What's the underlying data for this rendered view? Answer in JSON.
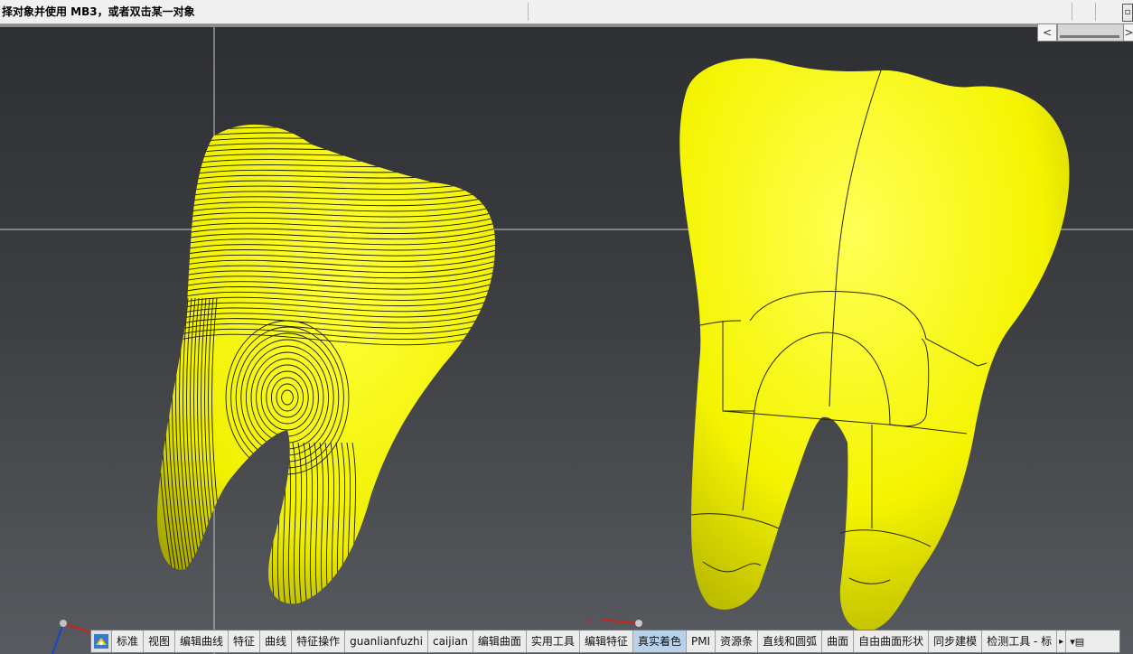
{
  "status": {
    "prompt": "择对象并使用 MB3，或者双击某一对象"
  },
  "scroll": {
    "left_arrow": "<",
    "right_arrow": ">"
  },
  "colors": {
    "tooth_fill": "#f2f200",
    "viewport_top": "#2d2f32",
    "viewport_bottom": "#575a5e",
    "toolbar_active": "#b8d2ec"
  },
  "toolbar": {
    "tabs": [
      {
        "label": "标准"
      },
      {
        "label": "视图"
      },
      {
        "label": "编辑曲线"
      },
      {
        "label": "特征"
      },
      {
        "label": "曲线"
      },
      {
        "label": "特征操作"
      },
      {
        "label": "guanlianfuzhi"
      },
      {
        "label": "caijian"
      },
      {
        "label": "编辑曲面"
      },
      {
        "label": "实用工具"
      },
      {
        "label": "编辑特征"
      },
      {
        "label": "真实着色",
        "active": true
      },
      {
        "label": "PMI"
      },
      {
        "label": "资源条"
      },
      {
        "label": "直线和圆弧"
      },
      {
        "label": "曲面"
      },
      {
        "label": "自由曲面形状"
      },
      {
        "label": "同步建模"
      },
      {
        "label": "检测工具 - 标"
      }
    ],
    "more_glyph": "▸",
    "menu_glyph": "▾▤"
  },
  "icons": [
    "app-logo-icon",
    "scroll-left-icon",
    "scroll-right-icon",
    "view-triad-icon",
    "toolbar-overflow-icon"
  ]
}
